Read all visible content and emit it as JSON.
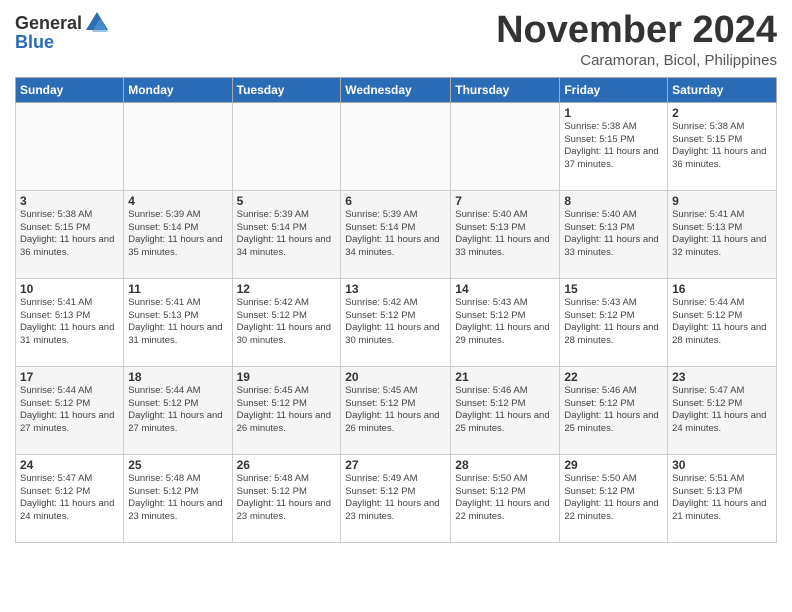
{
  "header": {
    "logo_general": "General",
    "logo_blue": "Blue",
    "month_title": "November 2024",
    "location": "Caramoran, Bicol, Philippines"
  },
  "weekdays": [
    "Sunday",
    "Monday",
    "Tuesday",
    "Wednesday",
    "Thursday",
    "Friday",
    "Saturday"
  ],
  "weeks": [
    [
      {
        "day": "",
        "info": ""
      },
      {
        "day": "",
        "info": ""
      },
      {
        "day": "",
        "info": ""
      },
      {
        "day": "",
        "info": ""
      },
      {
        "day": "",
        "info": ""
      },
      {
        "day": "1",
        "info": "Sunrise: 5:38 AM\nSunset: 5:15 PM\nDaylight: 11 hours and 37 minutes."
      },
      {
        "day": "2",
        "info": "Sunrise: 5:38 AM\nSunset: 5:15 PM\nDaylight: 11 hours and 36 minutes."
      }
    ],
    [
      {
        "day": "3",
        "info": "Sunrise: 5:38 AM\nSunset: 5:15 PM\nDaylight: 11 hours and 36 minutes."
      },
      {
        "day": "4",
        "info": "Sunrise: 5:39 AM\nSunset: 5:14 PM\nDaylight: 11 hours and 35 minutes."
      },
      {
        "day": "5",
        "info": "Sunrise: 5:39 AM\nSunset: 5:14 PM\nDaylight: 11 hours and 34 minutes."
      },
      {
        "day": "6",
        "info": "Sunrise: 5:39 AM\nSunset: 5:14 PM\nDaylight: 11 hours and 34 minutes."
      },
      {
        "day": "7",
        "info": "Sunrise: 5:40 AM\nSunset: 5:13 PM\nDaylight: 11 hours and 33 minutes."
      },
      {
        "day": "8",
        "info": "Sunrise: 5:40 AM\nSunset: 5:13 PM\nDaylight: 11 hours and 33 minutes."
      },
      {
        "day": "9",
        "info": "Sunrise: 5:41 AM\nSunset: 5:13 PM\nDaylight: 11 hours and 32 minutes."
      }
    ],
    [
      {
        "day": "10",
        "info": "Sunrise: 5:41 AM\nSunset: 5:13 PM\nDaylight: 11 hours and 31 minutes."
      },
      {
        "day": "11",
        "info": "Sunrise: 5:41 AM\nSunset: 5:13 PM\nDaylight: 11 hours and 31 minutes."
      },
      {
        "day": "12",
        "info": "Sunrise: 5:42 AM\nSunset: 5:12 PM\nDaylight: 11 hours and 30 minutes."
      },
      {
        "day": "13",
        "info": "Sunrise: 5:42 AM\nSunset: 5:12 PM\nDaylight: 11 hours and 30 minutes."
      },
      {
        "day": "14",
        "info": "Sunrise: 5:43 AM\nSunset: 5:12 PM\nDaylight: 11 hours and 29 minutes."
      },
      {
        "day": "15",
        "info": "Sunrise: 5:43 AM\nSunset: 5:12 PM\nDaylight: 11 hours and 28 minutes."
      },
      {
        "day": "16",
        "info": "Sunrise: 5:44 AM\nSunset: 5:12 PM\nDaylight: 11 hours and 28 minutes."
      }
    ],
    [
      {
        "day": "17",
        "info": "Sunrise: 5:44 AM\nSunset: 5:12 PM\nDaylight: 11 hours and 27 minutes."
      },
      {
        "day": "18",
        "info": "Sunrise: 5:44 AM\nSunset: 5:12 PM\nDaylight: 11 hours and 27 minutes."
      },
      {
        "day": "19",
        "info": "Sunrise: 5:45 AM\nSunset: 5:12 PM\nDaylight: 11 hours and 26 minutes."
      },
      {
        "day": "20",
        "info": "Sunrise: 5:45 AM\nSunset: 5:12 PM\nDaylight: 11 hours and 26 minutes."
      },
      {
        "day": "21",
        "info": "Sunrise: 5:46 AM\nSunset: 5:12 PM\nDaylight: 11 hours and 25 minutes."
      },
      {
        "day": "22",
        "info": "Sunrise: 5:46 AM\nSunset: 5:12 PM\nDaylight: 11 hours and 25 minutes."
      },
      {
        "day": "23",
        "info": "Sunrise: 5:47 AM\nSunset: 5:12 PM\nDaylight: 11 hours and 24 minutes."
      }
    ],
    [
      {
        "day": "24",
        "info": "Sunrise: 5:47 AM\nSunset: 5:12 PM\nDaylight: 11 hours and 24 minutes."
      },
      {
        "day": "25",
        "info": "Sunrise: 5:48 AM\nSunset: 5:12 PM\nDaylight: 11 hours and 23 minutes."
      },
      {
        "day": "26",
        "info": "Sunrise: 5:48 AM\nSunset: 5:12 PM\nDaylight: 11 hours and 23 minutes."
      },
      {
        "day": "27",
        "info": "Sunrise: 5:49 AM\nSunset: 5:12 PM\nDaylight: 11 hours and 23 minutes."
      },
      {
        "day": "28",
        "info": "Sunrise: 5:50 AM\nSunset: 5:12 PM\nDaylight: 11 hours and 22 minutes."
      },
      {
        "day": "29",
        "info": "Sunrise: 5:50 AM\nSunset: 5:12 PM\nDaylight: 11 hours and 22 minutes."
      },
      {
        "day": "30",
        "info": "Sunrise: 5:51 AM\nSunset: 5:13 PM\nDaylight: 11 hours and 21 minutes."
      }
    ]
  ]
}
